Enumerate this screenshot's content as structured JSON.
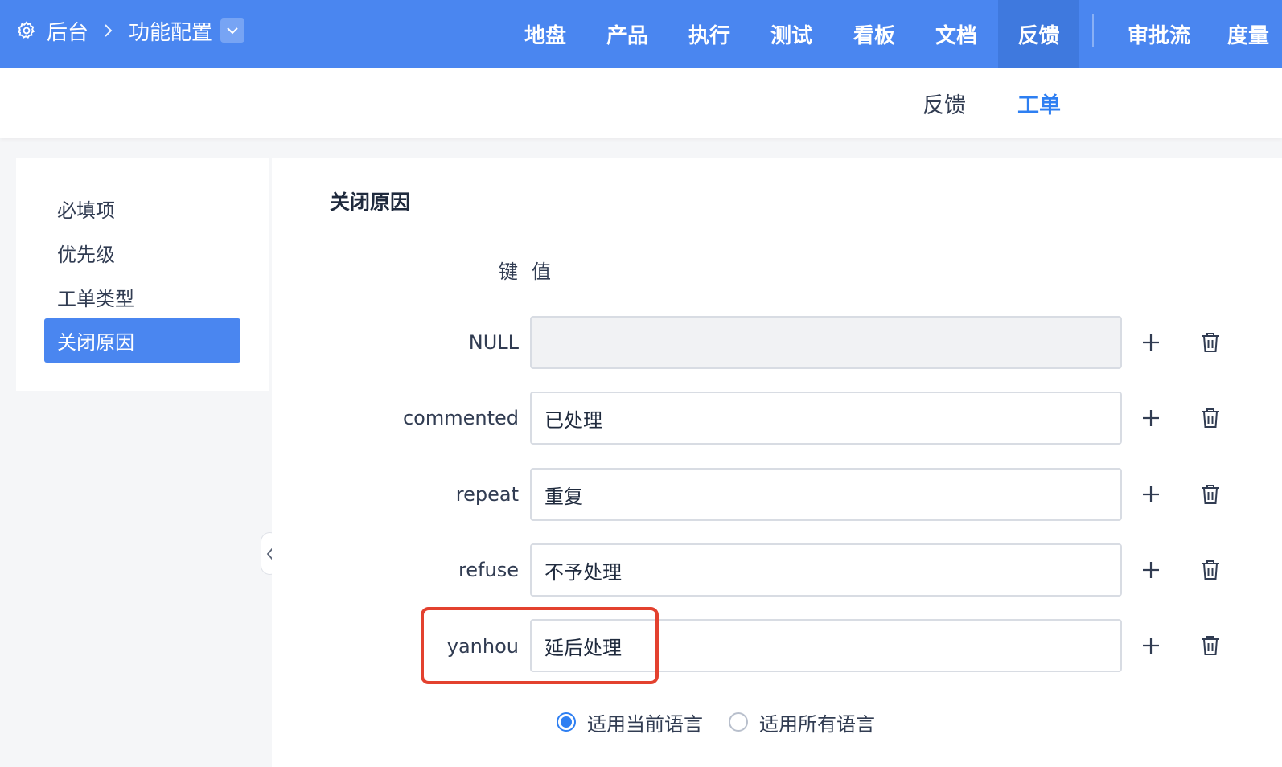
{
  "header": {
    "breadcrumb_root": "后台",
    "breadcrumb_current": "功能配置",
    "nav_items": [
      "地盘",
      "产品",
      "执行",
      "测试",
      "看板",
      "文档",
      "反馈",
      "审批流",
      "度量"
    ],
    "active_nav": "反馈"
  },
  "subnav": {
    "tabs": [
      "反馈",
      "工单"
    ],
    "active": "工单"
  },
  "sidebar": {
    "items": [
      "必填项",
      "优先级",
      "工单类型",
      "关闭原因"
    ],
    "active": "关闭原因"
  },
  "main": {
    "title": "关闭原因",
    "col_key": "键",
    "col_value": "值",
    "rows": [
      {
        "key": "NULL",
        "value": ""
      },
      {
        "key": "commented",
        "value": "已处理"
      },
      {
        "key": "repeat",
        "value": "重复"
      },
      {
        "key": "refuse",
        "value": "不予处理"
      },
      {
        "key": "yanhou",
        "value": "延后处理"
      }
    ],
    "lang_options": [
      "适用当前语言",
      "适用所有语言"
    ],
    "lang_selected": "适用当前语言"
  },
  "colors": {
    "primary": "#4a86f0",
    "accent_text": "#2e7ff2",
    "highlight_border": "#e3412f"
  }
}
